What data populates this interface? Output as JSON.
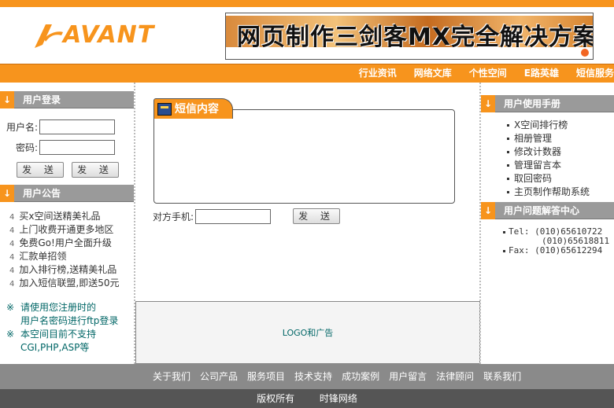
{
  "header": {
    "logo_text": "AVANT",
    "banner_text": "网页制作三剑客MX完全解决方案"
  },
  "nav": {
    "items": [
      "行业资讯",
      "网络文库",
      "个性空间",
      "E路英雄",
      "短信服务"
    ]
  },
  "login": {
    "title": "用户登录",
    "username_label": "用户名:",
    "password_label": "密码:",
    "button1": "发 送",
    "button2": "发 送"
  },
  "notice": {
    "title": "用户公告",
    "bullet": "4",
    "items": [
      "买x空间送精美礼品",
      "上门收费开通更多地区",
      "免费Go!用户全面升级",
      "汇款单招领",
      "加入排行榜,送精美礼品",
      "加入短信联盟,即送50元"
    ],
    "tip_mark": "※",
    "tip1_line1": "请使用您注册时的",
    "tip1_line2": "用户名密码进行ftp登录",
    "tip2_line1": "本空间目前不支持",
    "tip2_line2": "CGI,PHP,ASP等"
  },
  "sms": {
    "title": "短信内容",
    "phone_label": "对方手机:",
    "send_button": "发 送"
  },
  "ad": {
    "text": "LOGO和广告"
  },
  "manual": {
    "title": "用户使用手册",
    "items": [
      "X空间排行榜",
      "相册管理",
      "修改计数器",
      "管理留言本",
      "取回密码",
      "主页制作帮助系统"
    ]
  },
  "qa": {
    "title": "用户问题解答中心",
    "tel_label": "Tel:",
    "tel1": "(010)65610722",
    "tel2": "(010)65618811",
    "fax_label": "Fax:",
    "fax": "(010)65612294"
  },
  "footer": {
    "links": [
      "关于我们",
      "公司产品",
      "服务项目",
      "技术支持",
      "成功案例",
      "用户留言",
      "法律顾问",
      "联系我们"
    ],
    "copyright": "版权所有",
    "company": "时锋网络"
  },
  "colors": {
    "accent": "#f7941d",
    "gray_header": "#9a9a9a",
    "teal_text": "#006666"
  }
}
